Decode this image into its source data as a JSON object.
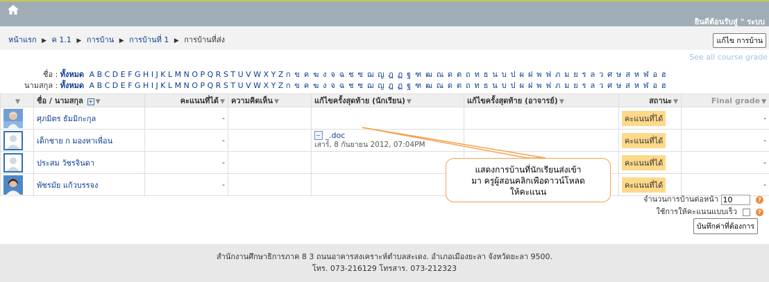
{
  "header": {
    "welcome": "ยินดีต้อนรับสู่ \" ระบบ"
  },
  "breadcrumb": {
    "items": [
      "หน้าแรก",
      "ค 1.1",
      "การบ้าน",
      "การบ้านที่ 1",
      "การบ้านที่ส่ง"
    ],
    "separator": "▶"
  },
  "actions": {
    "edit_label": "แก้ไข การบ้าน",
    "see_all": "See all course grade"
  },
  "filters": {
    "first_name_label": "ชื่อ :",
    "last_name_label": "นามสกุล :",
    "all_label": "ทั้งหมด",
    "latin": "A B C D E F G H I J K L M N O P Q R S T U V W X Y Z",
    "thai": "ก ข ค ฆ ง จ ฉ ช ซ ฌ ญ ฎ ฏ ฐ ฑ ฒ ณ ด ต ถ ท ธ น บ ป ผ ฝ พ ฟ ภ ม ย ร ล ว ศ ษ ส ห ฬ อ ฮ"
  },
  "table": {
    "columns": [
      "ชื่อ / นามสกุล",
      "คะแนนที่ได้",
      "ความคิดเห็น",
      "แก้ไขครั้งสุดท้าย (นักเรียน)",
      "แก้ไขครั้งสุดท้าย (อาจารย์)",
      "สถานะ",
      "Final grade"
    ],
    "rows": [
      {
        "name": "ศุภมิตร ธัมมิกะกุล",
        "score": "-",
        "file": "",
        "date": "",
        "status": "คะแนนที่ได้",
        "final": "-"
      },
      {
        "name": "เด็กชาย ก มองหาเพื่อน",
        "score": "-",
        "file": "_.doc",
        "date": "เสาร์, 8 กันยายน 2012, 07:04PM",
        "status": "คะแนนที่ได้",
        "final": "-"
      },
      {
        "name": "ประสม วัชรจินดา",
        "score": "-",
        "file": "",
        "date": "",
        "status": "คะแนนที่ได้",
        "final": "-"
      },
      {
        "name": "พัชรมัย แก้วบรรจง",
        "score": "-",
        "file": "",
        "date": "",
        "status": "คะแนนที่ได้",
        "final": "-"
      }
    ]
  },
  "options": {
    "per_page_label": "จำนวนการบ้านต่อหน้า",
    "per_page_value": "10",
    "quick_grading_label": "ใช้การให้คะแนนแบบเร็ว",
    "save_label": "บันทึกค่าที่ต้องการ"
  },
  "callout": {
    "line1": "แสดงการบ้านที่นักเรียนส่งเข้า",
    "line2": "มา ครูผู้สอนคลิกเพือดาวน์โหลด",
    "line3": "ให้คะแนน"
  },
  "footer": {
    "line1": "สำนักงานศึกษาธิการภาค 8 3 ถนนอาคารสงเคราะห์ตำบลสะเดง. อำเภอเมืองยะลา จังหวัดยะลา 9500.",
    "line2": "โทร. 073-216129 โทรสาร. 073-212323"
  },
  "colors": {
    "topbar": "#a0adb6",
    "link": "#0a3d91",
    "badge": "#ffd98a",
    "callout_border": "#f6a04d"
  }
}
